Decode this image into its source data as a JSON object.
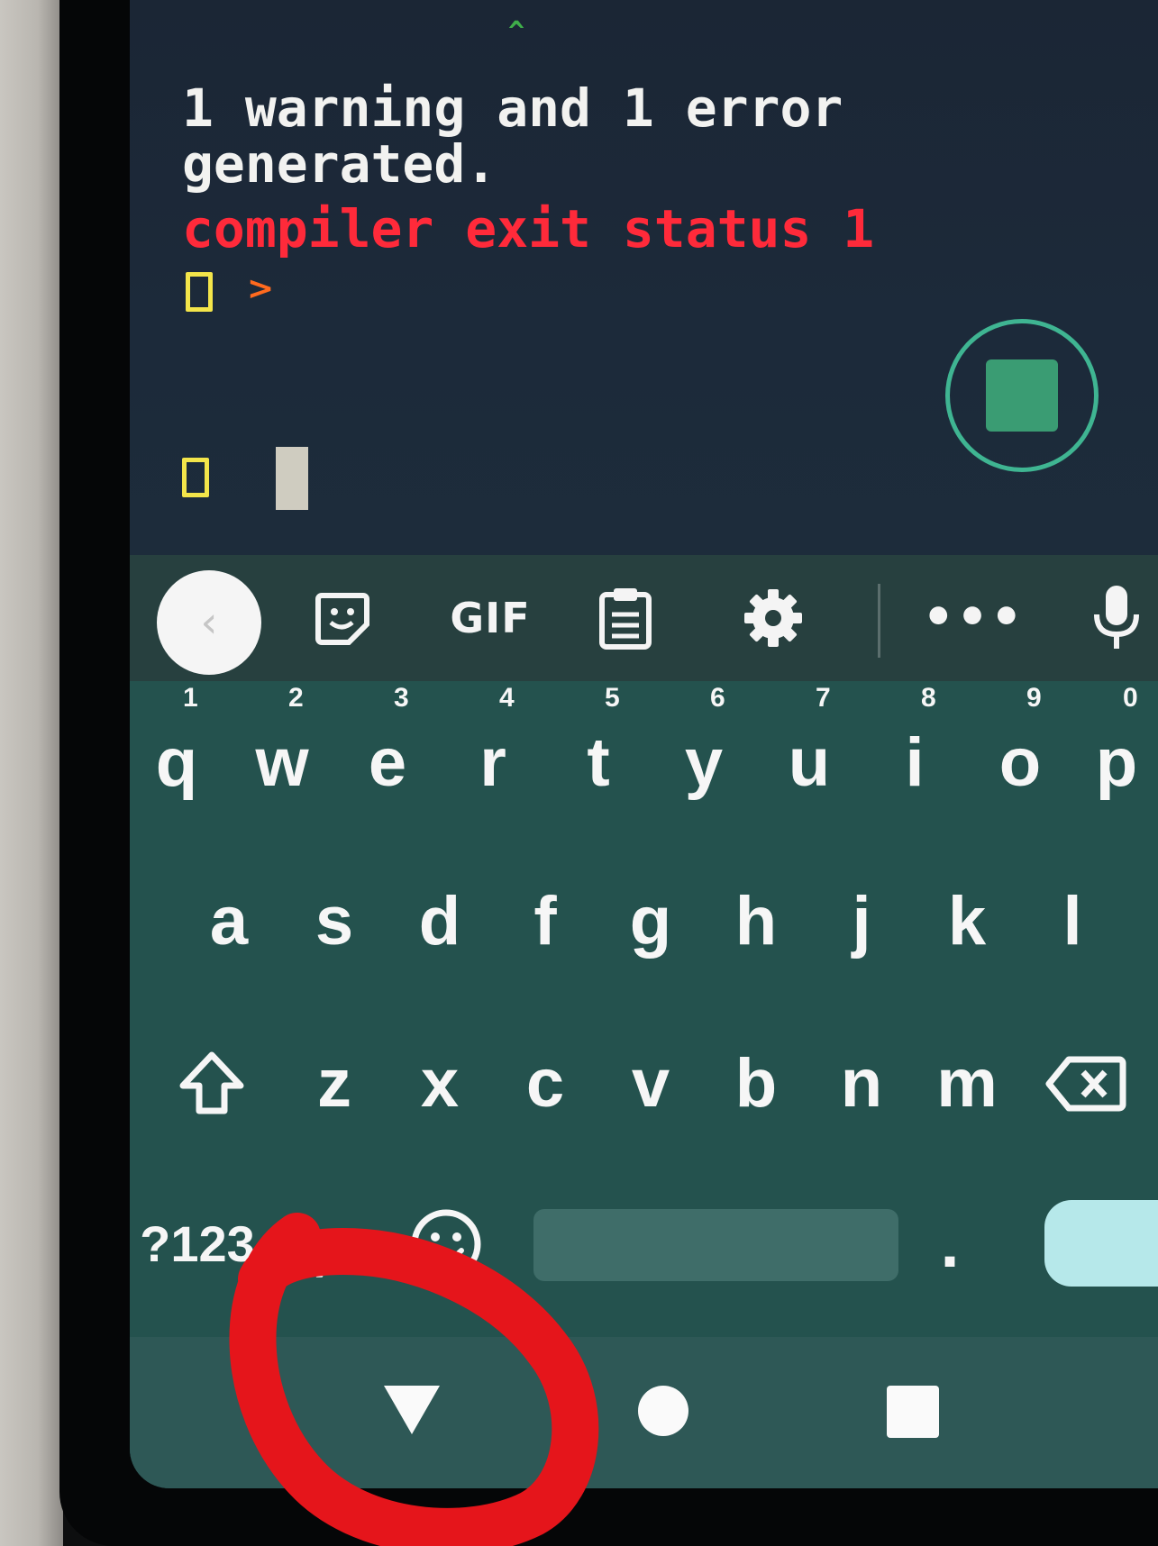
{
  "terminal": {
    "caret": "^",
    "lines": [
      "1 warning and 1 error",
      "generated.",
      "compiler exit status 1"
    ],
    "prompt_arrow": ">"
  },
  "stop_button": {
    "icon": "stop-icon"
  },
  "keyboard_toolbar": {
    "back_icon": "chevron-left-icon",
    "sticker_icon": "sticker-icon",
    "gif_label": "GIF",
    "clipboard_icon": "clipboard-icon",
    "settings_icon": "gear-icon",
    "more_label": "•••",
    "mic_icon": "microphone-icon"
  },
  "keyboard": {
    "row1": [
      {
        "key": "q",
        "hint": "1"
      },
      {
        "key": "w",
        "hint": "2"
      },
      {
        "key": "e",
        "hint": "3"
      },
      {
        "key": "r",
        "hint": "4"
      },
      {
        "key": "t",
        "hint": "5"
      },
      {
        "key": "y",
        "hint": "6"
      },
      {
        "key": "u",
        "hint": "7"
      },
      {
        "key": "i",
        "hint": "8"
      },
      {
        "key": "o",
        "hint": "9"
      },
      {
        "key": "p",
        "hint": "0"
      }
    ],
    "row2": [
      "a",
      "s",
      "d",
      "f",
      "g",
      "h",
      "j",
      "k",
      "l"
    ],
    "row3": [
      "z",
      "x",
      "c",
      "v",
      "b",
      "n",
      "m"
    ],
    "shift_icon": "shift-icon",
    "backspace_icon": "backspace-icon",
    "symbols_label": "?123",
    "comma_label": ",",
    "emoji_icon": "emoji-icon",
    "period_label": "."
  },
  "navbar": {
    "back_icon": "nav-back-triangle-icon",
    "home_icon": "nav-home-circle-icon",
    "recents_icon": "nav-recents-square-icon"
  },
  "colors": {
    "terminal_bg": "#1c2a3a",
    "error_text": "#ff2a3a",
    "prompt_yellow": "#f3e54a",
    "keyboard_bg": "#24524e",
    "toolbar_bg": "#27403f",
    "accent_green": "#3fb592",
    "annotation_red": "#e5151b"
  }
}
